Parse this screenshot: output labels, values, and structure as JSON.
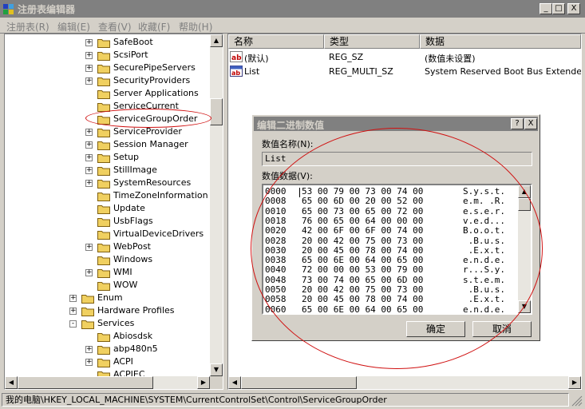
{
  "window": {
    "title": "注册表编辑器",
    "minimize": "_",
    "maximize": "□",
    "close": "X"
  },
  "menu": [
    {
      "label": "注册表(R)"
    },
    {
      "label": "编辑(E)"
    },
    {
      "label": "查看(V)"
    },
    {
      "label": "收藏(F)"
    },
    {
      "label": "帮助(H)"
    }
  ],
  "tree": {
    "items": [
      {
        "label": "SafeBoot",
        "toggle": "+"
      },
      {
        "label": "ScsiPort",
        "toggle": "+"
      },
      {
        "label": "SecurePipeServers",
        "toggle": "+"
      },
      {
        "label": "SecurityProviders",
        "toggle": "+"
      },
      {
        "label": "Server Applications",
        "toggle": ""
      },
      {
        "label": "ServiceCurrent",
        "toggle": ""
      },
      {
        "label": "ServiceGroupOrder",
        "toggle": ""
      },
      {
        "label": "ServiceProvider",
        "toggle": "+"
      },
      {
        "label": "Session Manager",
        "toggle": "+"
      },
      {
        "label": "Setup",
        "toggle": "+"
      },
      {
        "label": "StillImage",
        "toggle": "+"
      },
      {
        "label": "SystemResources",
        "toggle": "+"
      },
      {
        "label": "TimeZoneInformation",
        "toggle": ""
      },
      {
        "label": "Update",
        "toggle": ""
      },
      {
        "label": "UsbFlags",
        "toggle": ""
      },
      {
        "label": "VirtualDeviceDrivers",
        "toggle": ""
      },
      {
        "label": "WebPost",
        "toggle": "+"
      },
      {
        "label": "Windows",
        "toggle": ""
      },
      {
        "label": "WMI",
        "toggle": "+"
      },
      {
        "label": "WOW",
        "toggle": ""
      },
      {
        "label": "Enum",
        "toggle": "+"
      },
      {
        "label": "Hardware Profiles",
        "toggle": "+"
      },
      {
        "label": "Services",
        "toggle": "-"
      },
      {
        "label": "Abiosdsk",
        "toggle": ""
      },
      {
        "label": "abp480n5",
        "toggle": "+"
      },
      {
        "label": "ACPI",
        "toggle": "+"
      },
      {
        "label": "ACPIEC",
        "toggle": ""
      }
    ]
  },
  "values_list": {
    "headers": {
      "name": "名称",
      "type": "类型",
      "data": "数据"
    },
    "rows": [
      {
        "name": "(默认)",
        "type": "REG_SZ",
        "data": "(数值未设置)",
        "icon": "string-value-icon"
      },
      {
        "name": "List",
        "type": "REG_MULTI_SZ",
        "data": "System Reserved Boot Bus Extender Sys",
        "icon": "multi-string-value-icon"
      }
    ]
  },
  "dialog": {
    "title": "编辑二进制数值",
    "help": "?",
    "close": "X",
    "name_label": "数值名称(N):",
    "name_value": "List",
    "data_label": "数值数据(V):",
    "hex_rows": [
      {
        "addr": "0000",
        "bytes": "53 00 79 00 73 00 74 00",
        "ascii": "S.y.s.t."
      },
      {
        "addr": "0008",
        "bytes": "65 00 6D 00 20 00 52 00",
        "ascii": "e.m. .R."
      },
      {
        "addr": "0010",
        "bytes": "65 00 73 00 65 00 72 00",
        "ascii": "e.s.e.r."
      },
      {
        "addr": "0018",
        "bytes": "76 00 65 00 64 00 00 00",
        "ascii": "v.e.d..."
      },
      {
        "addr": "0020",
        "bytes": "42 00 6F 00 6F 00 74 00",
        "ascii": "B.o.o.t."
      },
      {
        "addr": "0028",
        "bytes": "20 00 42 00 75 00 73 00",
        "ascii": " .B.u.s."
      },
      {
        "addr": "0030",
        "bytes": "20 00 45 00 78 00 74 00",
        "ascii": " .E.x.t."
      },
      {
        "addr": "0038",
        "bytes": "65 00 6E 00 64 00 65 00",
        "ascii": "e.n.d.e."
      },
      {
        "addr": "0040",
        "bytes": "72 00 00 00 53 00 79 00",
        "ascii": "r...S.y."
      },
      {
        "addr": "0048",
        "bytes": "73 00 74 00 65 00 6D 00",
        "ascii": "s.t.e.m."
      },
      {
        "addr": "0050",
        "bytes": "20 00 42 00 75 00 73 00",
        "ascii": " .B.u.s."
      },
      {
        "addr": "0058",
        "bytes": "20 00 45 00 78 00 74 00",
        "ascii": " .E.x.t."
      },
      {
        "addr": "0060",
        "bytes": "65 00 6E 00 64 00 65 00",
        "ascii": "e.n.d.e."
      }
    ],
    "ok": "确定",
    "cancel": "取消"
  },
  "status": {
    "path": "我的电脑\\HKEY_LOCAL_MACHINE\\SYSTEM\\CurrentControlSet\\Control\\ServiceGroupOrder"
  },
  "colors": {
    "annotation": "#d01010",
    "titlebar_inactive": "#808080"
  }
}
